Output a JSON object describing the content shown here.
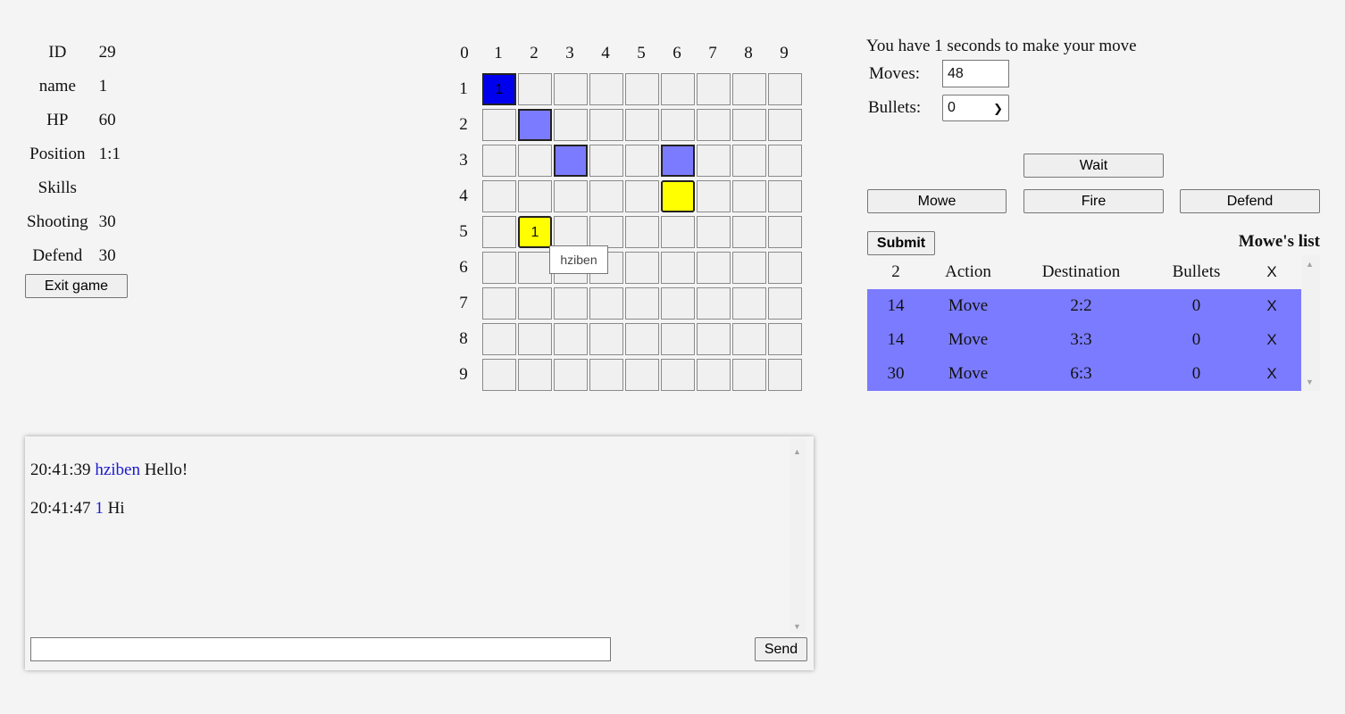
{
  "stats": {
    "rows": [
      {
        "label": "ID",
        "value": "29"
      },
      {
        "label": "name",
        "value": "1"
      },
      {
        "label": "HP",
        "value": "60"
      },
      {
        "label": "Position",
        "value": "1:1"
      },
      {
        "label": "Skills",
        "value": ""
      },
      {
        "label": "Shooting",
        "value": "30"
      },
      {
        "label": "Defend",
        "value": "30"
      }
    ],
    "exit_label": "Exit game"
  },
  "board": {
    "corner": "0",
    "cols": [
      "1",
      "2",
      "3",
      "4",
      "5",
      "6",
      "7",
      "8",
      "9"
    ],
    "rows": [
      "1",
      "2",
      "3",
      "4",
      "5",
      "6",
      "7",
      "8",
      "9"
    ],
    "cells": [
      {
        "col": 1,
        "row": 1,
        "type": "self",
        "text": "1"
      },
      {
        "col": 2,
        "row": 2,
        "type": "path",
        "text": ""
      },
      {
        "col": 3,
        "row": 3,
        "type": "path",
        "text": ""
      },
      {
        "col": 6,
        "row": 3,
        "type": "path",
        "text": ""
      },
      {
        "col": 6,
        "row": 4,
        "type": "enemy",
        "text": ""
      },
      {
        "col": 2,
        "row": 5,
        "type": "enemy",
        "text": "1"
      }
    ],
    "tooltip": "hziben"
  },
  "controls": {
    "timer_text": "You have 1 seconds to make your move",
    "moves_label": "Moves:",
    "moves_value": "48",
    "bullets_label": "Bullets:",
    "bullets_value": "0",
    "wait_label": "Wait",
    "mowe_label": "Mowe",
    "fire_label": "Fire",
    "defend_label": "Defend",
    "submit_label": "Submit",
    "list_title": "Mowe's list"
  },
  "move_list": {
    "headers": [
      "2",
      "Action",
      "Destination",
      "Bullets",
      "X"
    ],
    "rows": [
      [
        "14",
        "Move",
        "2:2",
        "0",
        "X"
      ],
      [
        "14",
        "Move",
        "3:3",
        "0",
        "X"
      ],
      [
        "30",
        "Move",
        "6:3",
        "0",
        "X"
      ]
    ]
  },
  "chat": {
    "messages": [
      {
        "time": "20:41:39",
        "user": "hziben",
        "text": "Hello!"
      },
      {
        "time": "20:41:47",
        "user": "1",
        "text": "Hi"
      }
    ],
    "input_value": "",
    "send_label": "Send"
  },
  "colors": {
    "self": "#0000ee",
    "path": "#7b7bff",
    "enemy": "#ffff00",
    "username": "#1a1acc"
  }
}
